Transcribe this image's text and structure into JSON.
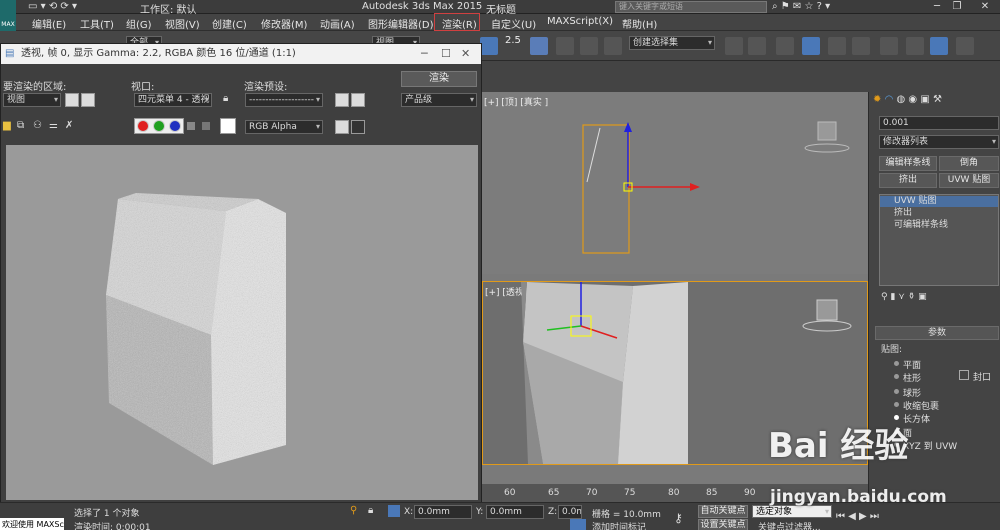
{
  "app": {
    "icon_label": "MAX",
    "workspace_label": "工作区: 默认",
    "title": "Autodesk 3ds Max  2015",
    "doc_title": "无标题",
    "search_placeholder": "键入关键字或短语"
  },
  "menu": [
    "编辑(E)",
    "工具(T)",
    "组(G)",
    "视图(V)",
    "创建(C)",
    "修改器(M)",
    "动画(A)",
    "图形编辑器(D)",
    "渲染(R)",
    "自定义(U)",
    "MAXScript(X)",
    "帮助(H)"
  ],
  "toolbar": {
    "filter_dropdown": "全部",
    "view_dropdown": "视图",
    "snap_value": "2.5",
    "selection_set": "创建选择集"
  },
  "render_window": {
    "title": "透视, 帧 0, 显示 Gamma: 2.2, RGBA 颜色 16 位/通道 (1:1)",
    "area_label": "要渲染的区域:",
    "area_value": "视图",
    "viewport_label": "视口:",
    "viewport_value": "四元菜单 4 - 透视",
    "preset_label": "渲染预设:",
    "preset_value": "--------------------",
    "render_button": "渲染",
    "quality_value": "产品级",
    "channel_value": "RGB Alpha"
  },
  "viewport": {
    "top_label": "[+] [顶] [真实 ]",
    "persp_label": "[+] [透视] [真实 ]",
    "timeline_ticks": [
      "60",
      "65",
      "70",
      "75",
      "80",
      "85",
      "90"
    ]
  },
  "command_panel": {
    "value_field": "0.001",
    "modifier_list": "修改器列表",
    "buttons": [
      "编辑样条线",
      "倒角",
      "挤出",
      "UVW 贴图"
    ],
    "stack": [
      "UVW 贴图",
      "挤出",
      "可编辑样条线"
    ],
    "params_title": "参数",
    "mapping_label": "贴图:",
    "mapping_options": [
      "平面",
      "柱形",
      "球形",
      "收缩包裹",
      "长方体",
      "面",
      "XYZ 到 UVW"
    ],
    "selected_option": "长方体",
    "cap_label": "封口"
  },
  "status": {
    "left_box": "欢迎使用 MAXSc",
    "selected_text": "选择了 1 个对象",
    "render_time_text": "渲染时间: 0:00:01",
    "x_label": "X:",
    "x_value": "0.0mm",
    "y_label": "Y:",
    "y_value": "0.0mm",
    "z_label": "Z:",
    "z_value": "0.0mm",
    "grid_text": "栅格 = 10.0mm",
    "auto_key": "自动关键点",
    "selected_object": "选定对象",
    "set_key": "设置关键点",
    "key_filter": "关键点过滤器...",
    "add_time_tag": "添加时间标记"
  },
  "watermark": {
    "brand": "Bai 经验",
    "url": "jingyan.baidu.com"
  },
  "colors": {
    "accent_orange": "#e09a1a",
    "menu_highlight": "#d04040",
    "axis_red": "#e02020",
    "axis_blue": "#2020e0",
    "axis_green": "#20c020"
  }
}
